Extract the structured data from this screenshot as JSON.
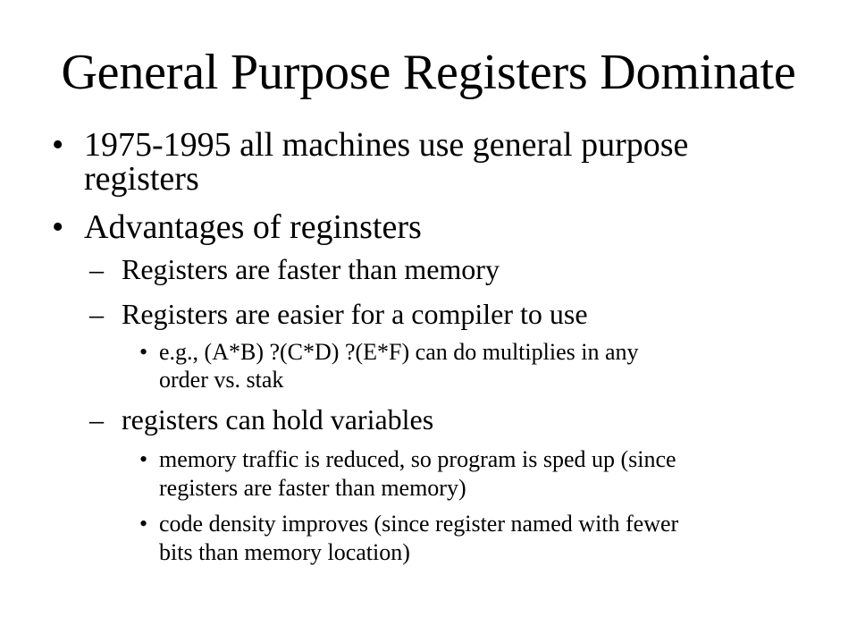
{
  "slide": {
    "title": "General Purpose Registers Dominate",
    "bullets": [
      {
        "marker": "•",
        "lines": [
          "1975-1995 all machines use general purpose",
          "registers"
        ]
      },
      {
        "marker": "•",
        "lines": [
          "Advantages of reginsters"
        ]
      }
    ],
    "sub_items": [
      {
        "marker": "–",
        "text": "Registers are faster than memory"
      },
      {
        "marker": "–",
        "text": "Registers are easier for a compiler to use"
      },
      {
        "marker": "–",
        "text": "registers can hold variables"
      }
    ],
    "sub_sub_items": [
      {
        "marker": "•",
        "lines": [
          "e.g., (A*B) ?(C*D) ?(E*F) can do multiplies in any",
          "order vs. stak"
        ]
      },
      {
        "marker": "•",
        "lines": [
          "memory traffic is reduced, so program is sped up (since",
          "registers are faster than memory)"
        ]
      },
      {
        "marker": "•",
        "lines": [
          "code density improves (since register named with fewer",
          "bits than memory location)"
        ]
      }
    ]
  }
}
